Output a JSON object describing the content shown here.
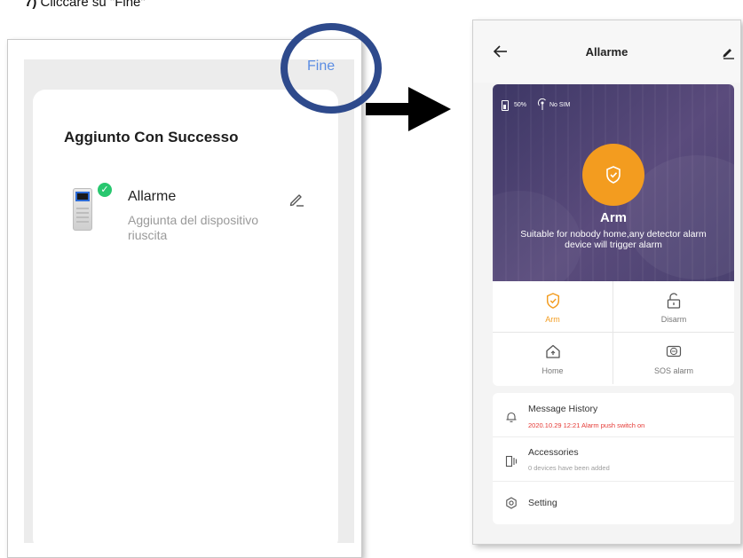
{
  "caption": {
    "step": "7)",
    "text": "Cliccare su \"Fine\""
  },
  "left_screen": {
    "done_label": "Fine",
    "title": "Aggiunto Con Successo",
    "device": {
      "name": "Allarme",
      "status": "Aggiunta del dispositivo riuscita"
    }
  },
  "right_screen": {
    "header": {
      "title": "Allarme"
    },
    "status": {
      "battery": "50%",
      "sim": "No SIM"
    },
    "current_mode": {
      "name": "Arm",
      "description": "Suitable for nobody home,any detector alarm device will trigger alarm"
    },
    "modes": [
      {
        "label": "Arm",
        "icon": "shield-check-icon",
        "active": true
      },
      {
        "label": "Disarm",
        "icon": "unlock-icon",
        "active": false
      },
      {
        "label": "Home",
        "icon": "home-icon",
        "active": false
      },
      {
        "label": "SOS alarm",
        "icon": "sos-icon",
        "active": false
      }
    ],
    "menu": {
      "history": {
        "title": "Message History",
        "subtitle": "2020.10.29 12:21 Alarm push switch on",
        "icon": "bell-icon"
      },
      "accessories": {
        "title": "Accessories",
        "subtitle": "0 devices have been added",
        "icon": "accessory-icon"
      },
      "setting": {
        "title": "Setting",
        "icon": "gear-icon"
      }
    }
  },
  "colors": {
    "accent_orange": "#f39c1f",
    "link_blue": "#5b8de3",
    "ring_navy": "#2e4a8c",
    "hero_purple": "#4a416f",
    "success_green": "#28c76f",
    "alert_red": "#e53935"
  }
}
